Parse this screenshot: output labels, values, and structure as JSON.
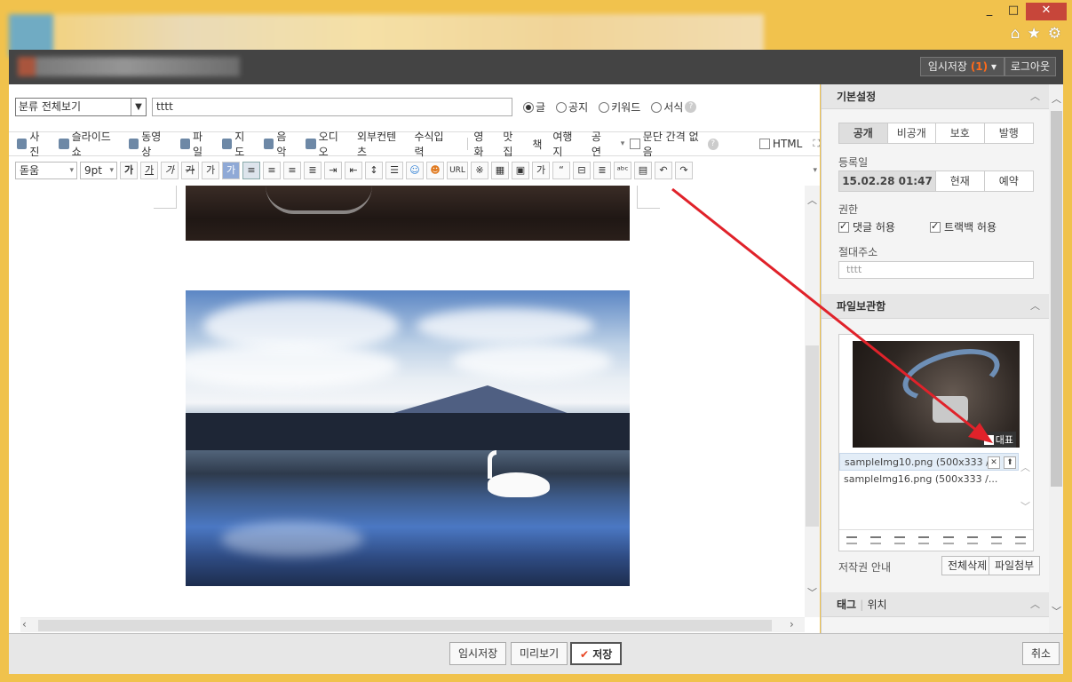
{
  "window": {
    "controls": [
      "_",
      "□",
      "✕"
    ],
    "browser_icons": [
      "home-icon",
      "star-icon",
      "gear-icon"
    ]
  },
  "appbar": {
    "draft_label": "임시저장",
    "draft_count": "(1)",
    "login_label": "로그아웃"
  },
  "editor": {
    "category": "분류 전체보기",
    "title_value": "tttt",
    "types": [
      {
        "label": "글",
        "checked": true
      },
      {
        "label": "공지",
        "checked": false
      },
      {
        "label": "키워드",
        "checked": false
      },
      {
        "label": "서식",
        "checked": false
      }
    ],
    "insert_toolbar": [
      "사진",
      "슬라이드쇼",
      "동영상",
      "파일",
      "지도",
      "음악",
      "오디오",
      "외부컨텐츠",
      "수식입력"
    ],
    "category_toolbar": [
      "영화",
      "맛집",
      "책",
      "여행지",
      "공연"
    ],
    "paragraph_spacing": "문단 간격 없음",
    "html_label": "HTML",
    "font": "돋움",
    "font_size": "9pt",
    "format_buttons": [
      "가",
      "가",
      "가",
      "가",
      "가"
    ],
    "url_label": "URL"
  },
  "bottombar": {
    "draft": "임시저장",
    "preview": "미리보기",
    "save": "저장",
    "cancel": "취소"
  },
  "panel": {
    "basic_settings": "기본설정",
    "visibility": [
      {
        "label": "공개",
        "on": true
      },
      {
        "label": "비공개",
        "on": false
      },
      {
        "label": "보호",
        "on": false
      },
      {
        "label": "발행",
        "on": false
      }
    ],
    "date_label": "등록일",
    "date_value": "15.02.28 01:47",
    "date_now": "현재",
    "date_reserve": "예약",
    "permission_label": "권한",
    "allow_comments": "댓글 허용",
    "allow_trackback": "트랙백 허용",
    "permalink_label": "절대주소",
    "permalink_value": "tttt",
    "file_box": "파일보관함",
    "representative": "대표",
    "files": [
      "sampleImg10.png (500x333 /...",
      "sampleImg16.png (500x333 /..."
    ],
    "copyright": "저작권 안내",
    "delete_all": "전체삭제",
    "attach_file": "파일첨부",
    "tag_tab": "태그",
    "location_tab": "위치"
  },
  "colors": {
    "window_frame": "#f1c24d",
    "close_button": "#c7463a",
    "annotation_arrow": "#e0222a",
    "draft_count": "#ff6b1a"
  }
}
